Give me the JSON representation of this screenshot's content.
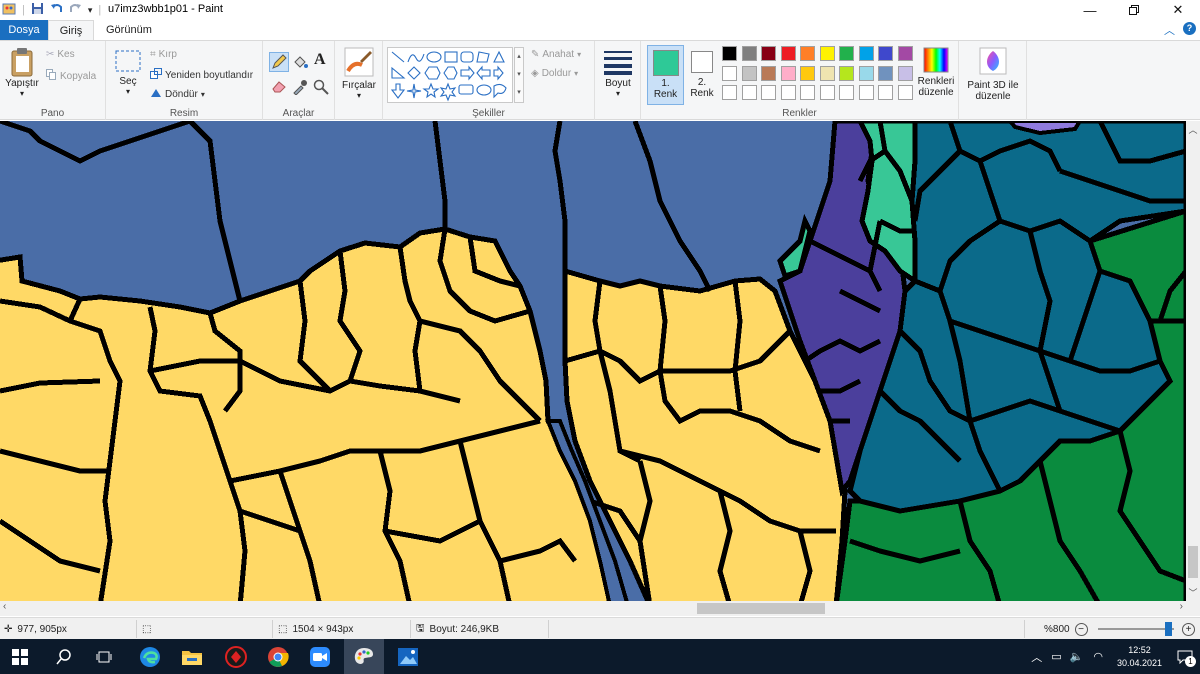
{
  "window": {
    "title": "u7imz3wbb1p01 - Paint",
    "minimize_icon": "minimize-icon",
    "maximize_icon": "restore-icon",
    "close_icon": "close-icon"
  },
  "tabs": {
    "file": "Dosya",
    "home": "Giriş",
    "view": "Görünüm"
  },
  "ribbon": {
    "clipboard": {
      "label": "Pano",
      "paste": "Yapıştır",
      "cut": "Kes",
      "copy": "Kopyala"
    },
    "image": {
      "label": "Resim",
      "select": "Seç",
      "crop": "Kırp",
      "resize": "Yeniden boyutlandır",
      "rotate": "Döndür"
    },
    "tools": {
      "label": "Araçlar"
    },
    "brushes": {
      "label": "Fırçalar"
    },
    "shapes": {
      "label": "Şekiller",
      "outline": "Anahat",
      "fill": "Doldur"
    },
    "size": {
      "label": "Boyut"
    },
    "colors": {
      "label": "Renkler",
      "color1_line1": "1.",
      "color1_line2": "Renk",
      "color2_line1": "2.",
      "color2_line2": "Renk",
      "edit_colors_line1": "Renkleri",
      "edit_colors_line2": "düzenle",
      "color1_value": "#2ec997",
      "color2_value": "#ffffff",
      "palette_row1": [
        "#000000",
        "#7f7f7f",
        "#880015",
        "#ed1c24",
        "#ff7f27",
        "#fff200",
        "#22b14c",
        "#00a2e8",
        "#3f48cc",
        "#a349a4"
      ],
      "palette_row2": [
        "#ffffff",
        "#c3c3c3",
        "#b97a57",
        "#ffaec9",
        "#ffc90e",
        "#efe4b0",
        "#b5e61d",
        "#99d9ea",
        "#7092be",
        "#c8bfe7"
      ]
    },
    "paint3d": {
      "line1": "Paint 3D ile",
      "line2": "düzenle"
    }
  },
  "canvas_colors": {
    "blue": "#4a6da7",
    "yellow": "#ffd966",
    "purple": "#4b3f9c",
    "teal": "#0b6a8a",
    "green": "#0a8b3e",
    "mint": "#38c796",
    "lavender": "#8f7bde",
    "border": "#000000"
  },
  "status": {
    "cursor": "977, 905px",
    "dimensions": "1504 × 943px",
    "filesize": "Boyut: 246,9KB",
    "zoom": "%800"
  },
  "taskbar": {
    "time": "12:52",
    "date": "30.04.2021",
    "notification_count": "1"
  }
}
